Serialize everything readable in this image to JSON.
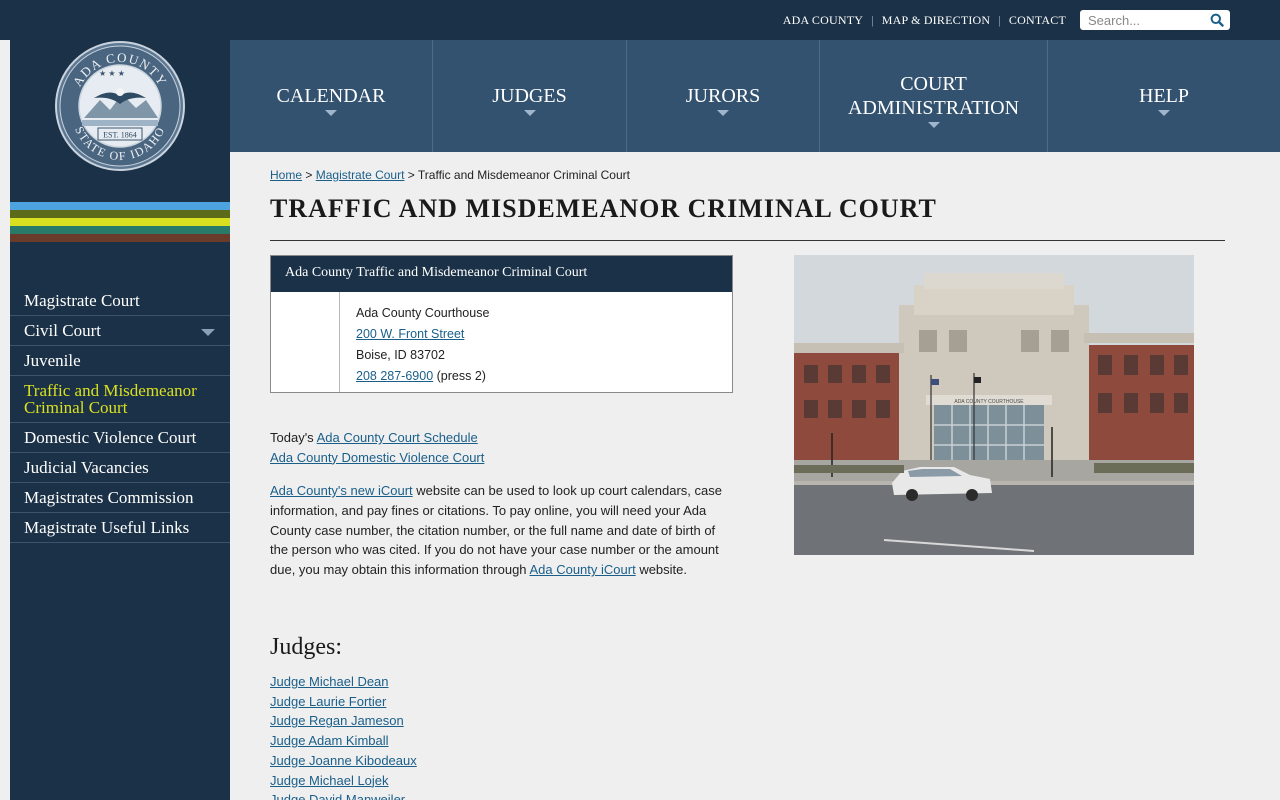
{
  "topbar": {
    "links": [
      "ADA COUNTY",
      "MAP & DIRECTION",
      "CONTACT"
    ],
    "search_placeholder": "Search..."
  },
  "seal": {
    "text_top": "ADA COUNTY",
    "text_bottom": "STATE OF IDAHO",
    "established": "EST. 1864"
  },
  "colors": {
    "dark_navy": "#1b3147",
    "nav_blue": "#32526f",
    "link": "#1a5f8a",
    "active_nav": "#d9e021",
    "stripes": [
      "#4da3df",
      "#5b6b1a",
      "#d9e021",
      "#2a7a6a",
      "#6b3b2a"
    ]
  },
  "mainnav": {
    "items": [
      "CALENDAR",
      "JUDGES",
      "JURORS",
      "COURT ADMINISTRATION",
      "HELP"
    ]
  },
  "sidenav": {
    "items": [
      {
        "label": "Magistrate Court"
      },
      {
        "label": "Civil Court"
      },
      {
        "label": "Juvenile"
      },
      {
        "label": "Traffic and Misdemeanor Criminal Court"
      },
      {
        "label": "Domestic Violence Court"
      },
      {
        "label": "Judicial Vacancies"
      },
      {
        "label": "Magistrates Commission"
      },
      {
        "label": "Magistrate Useful Links"
      }
    ]
  },
  "breadcrumb": {
    "home": "Home",
    "sep": ">",
    "parent": "Magistrate Court",
    "current": "Traffic and Misdemeanor Criminal Court"
  },
  "page_title": "TRAFFIC AND MISDEMEANOR CRIMINAL COURT",
  "infobox": {
    "header": "Ada County Traffic and Misdemeanor Criminal Court",
    "building": "Ada County Courthouse",
    "street": "200 W. Front Street",
    "city": "Boise, ID 83702",
    "phone": "208 287-6900",
    "phone_note": "(press 2)"
  },
  "schedule": {
    "prefix": "Today's",
    "schedule_link": "Ada County Court Schedule",
    "dv_link": "Ada County Domestic Violence Court"
  },
  "icourt": {
    "link1": "Ada County's new iCourt",
    "text1": "website  can be used to look up court calendars, case information, and pay fines or citations. To pay online, you will need your Ada County case number, the citation number, or the full name and date of birth of the person who was cited. If you do not have your case number or the amount due, you may obtain this information through",
    "link2": "Ada County iCourt",
    "text2": "website."
  },
  "judges": {
    "heading": "Judges:",
    "list": [
      "Judge Michael Dean",
      "Judge Laurie Fortier",
      "Judge Regan Jameson",
      "Judge Adam Kimball",
      "Judge Joanne Kibodeaux",
      "Judge Michael Lojek",
      "Judge David Manweiler"
    ]
  },
  "photo": {
    "sign": "ADA COUNTY COURTHOUSE"
  }
}
